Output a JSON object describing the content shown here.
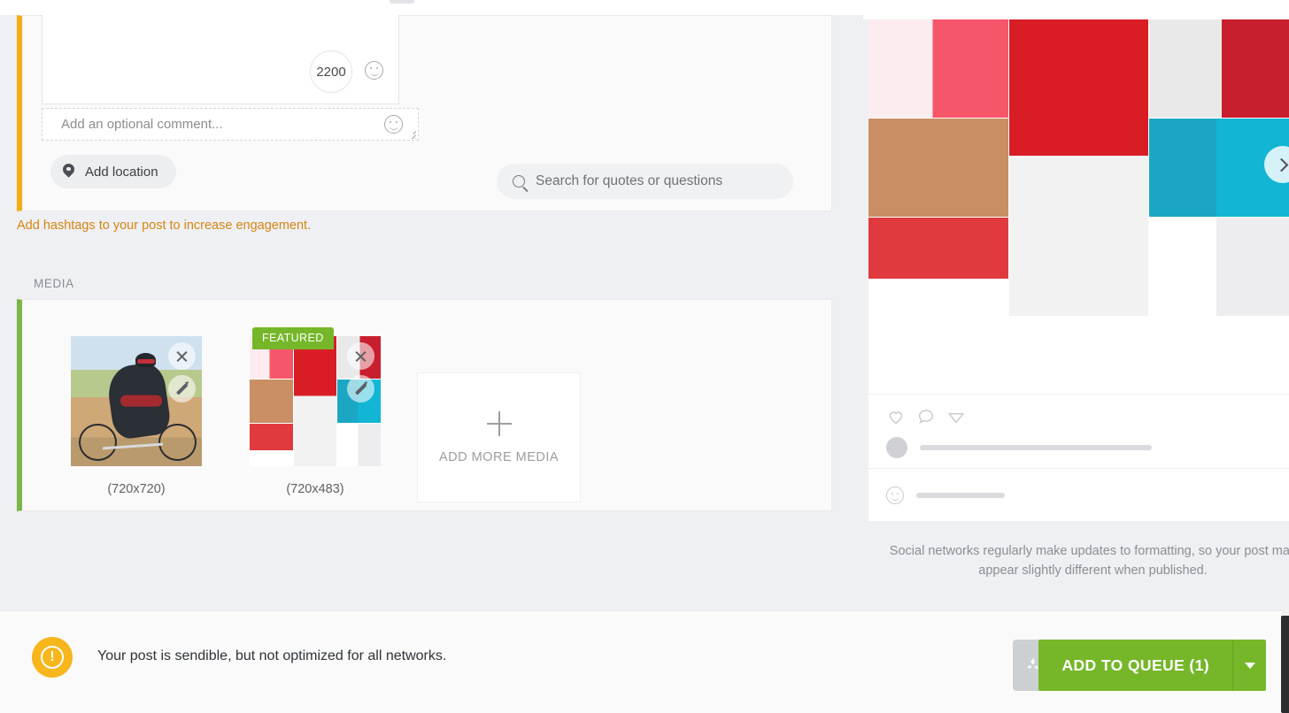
{
  "composer": {
    "char_count": "2200",
    "comment_placeholder": "Add an optional comment...",
    "location_label": "Add location",
    "emoji_icon": "smiley-icon",
    "hashtag_hint": "Add hashtags to your post to increase engagement."
  },
  "search": {
    "placeholder": "Search for quotes or questions",
    "icon": "search-icon"
  },
  "media": {
    "section_label": "MEDIA",
    "featured_badge": "FEATURED",
    "add_more_label": "ADD MORE MEDIA",
    "items": [
      {
        "dimensions": "(720x720)",
        "alt": "cyclist-photo",
        "featured": false
      },
      {
        "dimensions": "(720x483)",
        "alt": "magazine-collage",
        "featured": true
      }
    ],
    "thumb_actions": [
      "remove-icon",
      "edit-icon"
    ]
  },
  "preview": {
    "carousel_next_icon": "chevron-right-icon",
    "action_icons": [
      "heart-icon",
      "comment-icon",
      "share-icon"
    ],
    "comment_emoji_icon": "smiley-icon",
    "disclaimer": "Social networks regularly make updates to formatting, so your post may appear slightly different when published."
  },
  "footer": {
    "status_icon": "warning-icon",
    "status_text": "Your post is sendible, but not optimized for all networks.",
    "recycle_icon": "recycle-icon",
    "queue_button_label": "ADD TO QUEUE (1)",
    "queue_caret_icon": "caret-down-icon"
  },
  "colors": {
    "amber": "#f5ad16",
    "green": "#76b72a",
    "warning": "#f6b61c",
    "hint_text": "#d58512"
  }
}
